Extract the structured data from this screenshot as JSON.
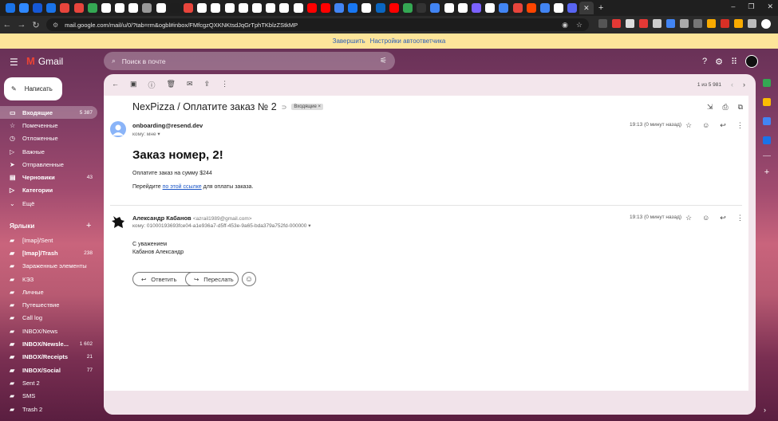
{
  "browser": {
    "url": "mail.google.com/mail/u/0/?tab=rm&ogbl#inbox/FMfcgzQXKNKtsdJqGrTphTKblzZStkMP",
    "tab_colors": [
      "#1a73e8",
      "#2f88ff",
      "#1558d6",
      "#1a73e8",
      "#e8453c",
      "#e8453c",
      "#34a853",
      "#fff",
      "#fff",
      "#fff",
      "#999",
      "#fff",
      "#1e1e1e",
      "#e8453c",
      "#fff",
      "#fff",
      "#fff",
      "#fff",
      "#fff",
      "#fff",
      "#fff",
      "#fff",
      "#ff0000",
      "#ff0000",
      "#4285f4",
      "#1877f2",
      "#fff",
      "#0a66c2",
      "#ff0000",
      "#34a853",
      "#333",
      "#4285f4",
      "#fff",
      "#fff",
      "#7b61ff",
      "#fff",
      "#4285f4",
      "#e8453c",
      "#ff4500",
      "#4285f4",
      "#fff",
      "#5865f2"
    ],
    "new_tab_label": "+",
    "win_minimize": "–",
    "win_restore": "❐",
    "win_close": "✕"
  },
  "infobar": {
    "enable_link": "Завершить",
    "settings_link": "Настройки автоответчика"
  },
  "header": {
    "app_name": "Gmail",
    "search_placeholder": "Поиск в почте"
  },
  "compose": {
    "label": "Написать"
  },
  "sidebar": {
    "items": [
      {
        "label": "Входящие",
        "count": "5 387",
        "icon": "▭",
        "active": true,
        "bold": true
      },
      {
        "label": "Помеченные",
        "count": "",
        "icon": "☆"
      },
      {
        "label": "Отложенные",
        "count": "",
        "icon": "◷"
      },
      {
        "label": "Важные",
        "count": "",
        "icon": "▷"
      },
      {
        "label": "Отправленные",
        "count": "",
        "icon": "➤"
      },
      {
        "label": "Черновики",
        "count": "43",
        "icon": "▤",
        "bold": true
      },
      {
        "label": "Категории",
        "count": "",
        "icon": "▷",
        "bold": true
      },
      {
        "label": "Ещё",
        "count": "",
        "icon": "⌄"
      }
    ],
    "labels_title": "Ярлыки",
    "labels": [
      {
        "label": "[Imap]/Sent",
        "count": ""
      },
      {
        "label": "[Imap]/Trash",
        "count": "238",
        "bold": true
      },
      {
        "label": "Зараженные элементы",
        "count": ""
      },
      {
        "label": "КЭЗ",
        "count": ""
      },
      {
        "label": "Личные",
        "count": ""
      },
      {
        "label": "Путешествие",
        "count": ""
      },
      {
        "label": "Call log",
        "count": ""
      },
      {
        "label": "INBOX/News",
        "count": ""
      },
      {
        "label": "INBOX/Newsle...",
        "count": "1 602",
        "bold": true
      },
      {
        "label": "INBOX/Receipts",
        "count": "21",
        "bold": true
      },
      {
        "label": "INBOX/Social",
        "count": "77",
        "bold": true
      },
      {
        "label": "Sent 2",
        "count": ""
      },
      {
        "label": "SMS",
        "count": ""
      },
      {
        "label": "Trash 2",
        "count": ""
      }
    ]
  },
  "mail": {
    "pager_text": "1 из 5 981",
    "subject": "NexPizza / Оплатите заказ № 2",
    "badge": "Входящие",
    "badge_close": "×",
    "messages": [
      {
        "sender": "onboarding@resend.dev",
        "to": "кому: мне",
        "time": "19:13 (0 минут назад)",
        "heading": "Заказ номер, 2!",
        "line1": "Оплатите заказ на сумму $244",
        "line2_before": "Перейдите ",
        "line2_link": "по этой ссылке",
        "line2_after": " для оплаты заказа."
      },
      {
        "sender": "Александр Кабанов",
        "sender_email": "<azrail1989@gmail.com>",
        "to": "кому: 01000193693fce04-a1e936a7-d5ff-453e-9a65-bda379a752fd-000000",
        "time": "19:13 (0 минут назад)",
        "line1": "С уважением",
        "line2": "Кабанов Александр"
      }
    ],
    "reply_label": "Ответить",
    "forward_label": "Переслать"
  },
  "colors": {
    "accent_red": "#ea4335",
    "link_blue": "#1a55c6",
    "infobar_bg": "#fde59a"
  }
}
